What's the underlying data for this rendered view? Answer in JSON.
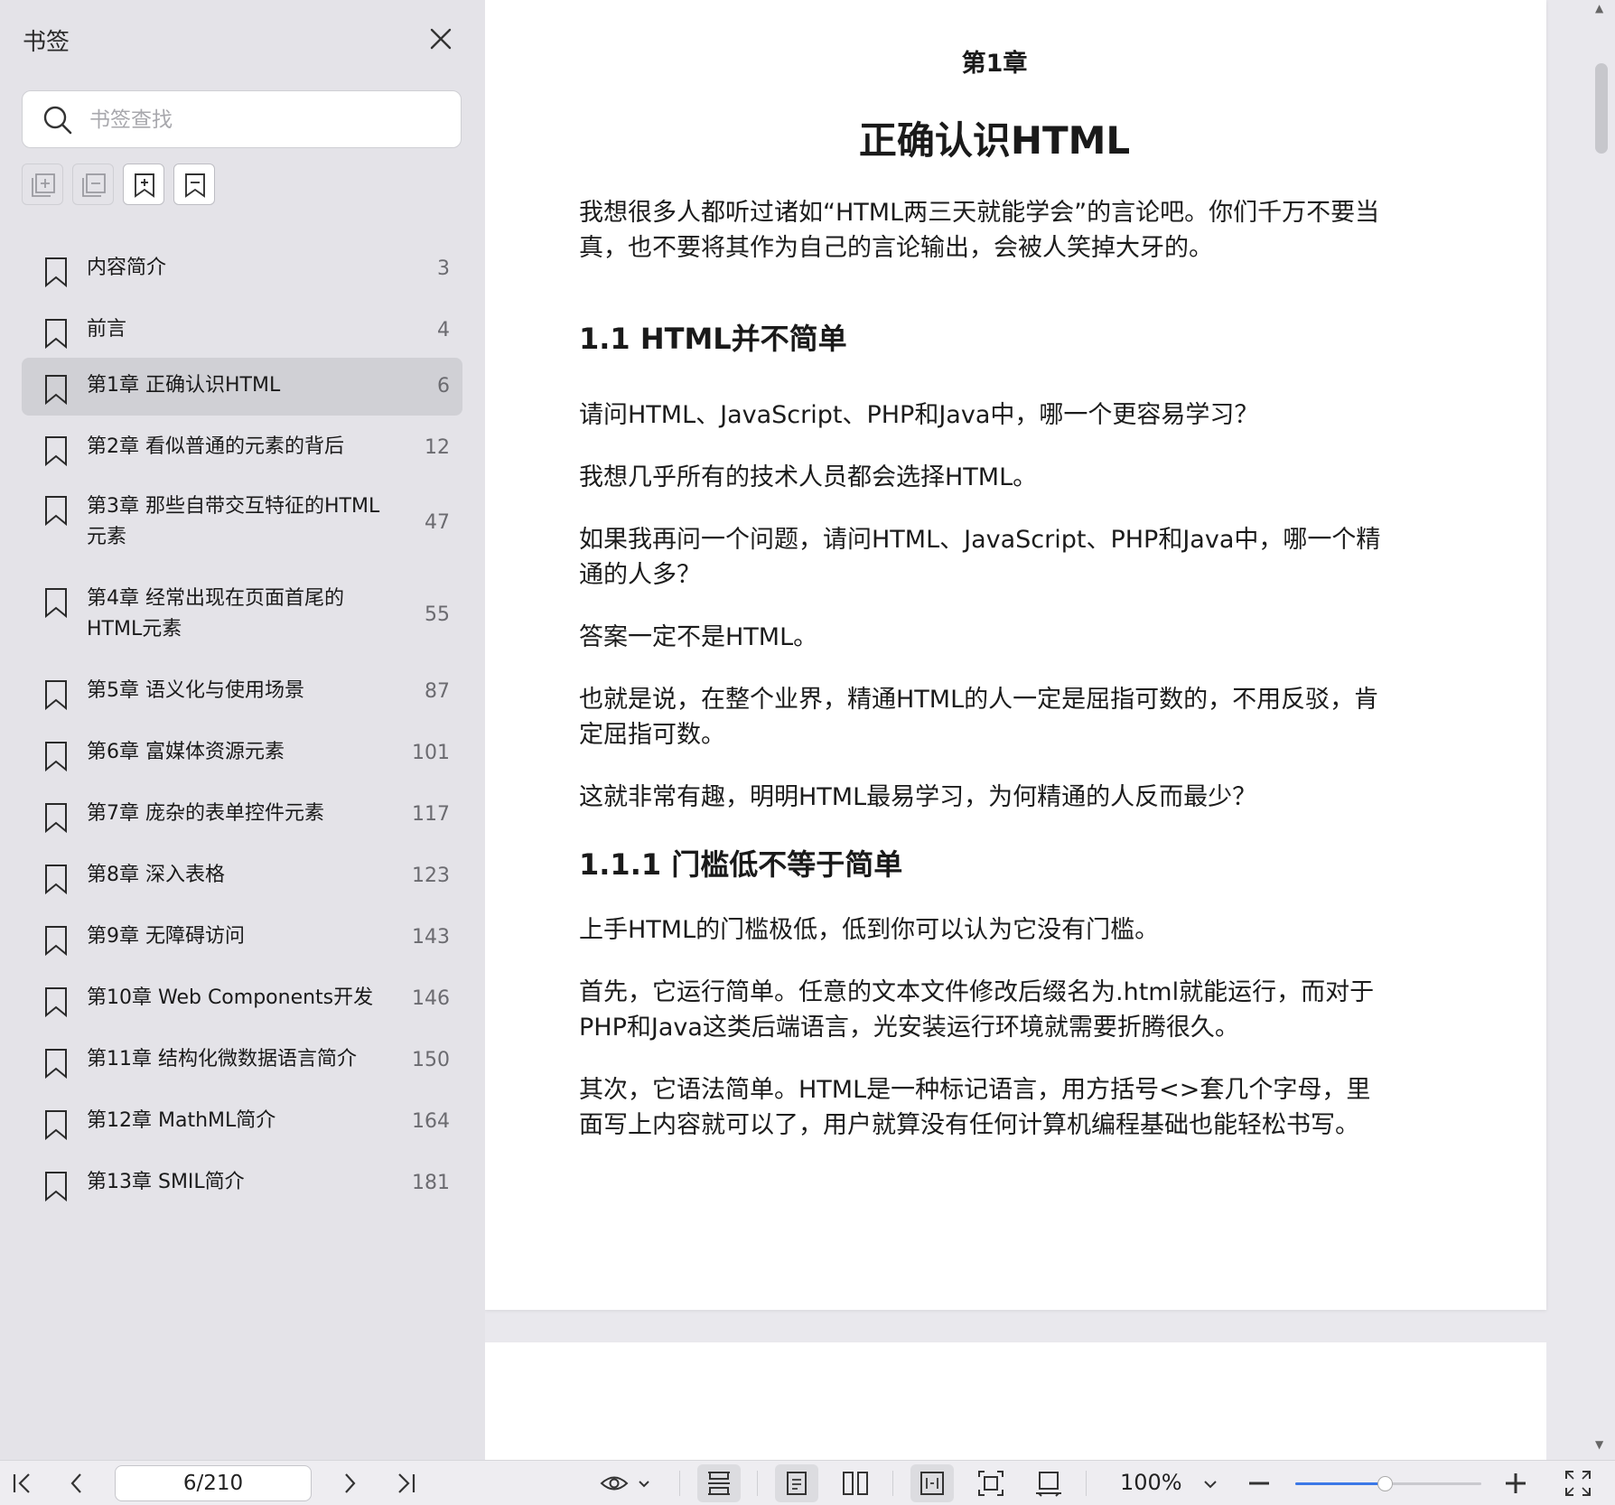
{
  "sidebar": {
    "title": "书签",
    "search_placeholder": "书签查找",
    "tools": [
      "expand-all-icon",
      "collapse-all-icon",
      "add-bookmark-icon",
      "bookmark-icon"
    ],
    "items": [
      {
        "label": "内容简介",
        "page": "3"
      },
      {
        "label": "前言",
        "page": "4"
      },
      {
        "label": "第1章 正确认识HTML",
        "page": "6",
        "active": true
      },
      {
        "label": "第2章 看似普通的元素的背后",
        "page": "12"
      },
      {
        "label": "第3章 那些自带交互特征的HTML元素",
        "page": "47"
      },
      {
        "label": "第4章 经常出现在页面首尾的HTML元素",
        "page": "55"
      },
      {
        "label": "第5章 语义化与使用场景",
        "page": "87"
      },
      {
        "label": "第6章 富媒体资源元素",
        "page": "101"
      },
      {
        "label": "第7章 庞杂的表单控件元素",
        "page": "117"
      },
      {
        "label": "第8章 深入表格",
        "page": "123"
      },
      {
        "label": "第9章 无障碍访问",
        "page": "143"
      },
      {
        "label": "第10章 Web Components开发",
        "page": "146"
      },
      {
        "label": "第11章 结构化微数据语言简介",
        "page": "150"
      },
      {
        "label": "第12章 MathML简介",
        "page": "164"
      },
      {
        "label": "第13章 SMIL简介",
        "page": "181"
      }
    ]
  },
  "document": {
    "chapter_label": "第1章",
    "chapter_title": "正确认识HTML",
    "intro": "我想很多人都听过诸如“HTML两三天就能学会”的言论吧。你们千万不要当真，也不要将其作为自己的言论输出，会被人笑掉大牙的。",
    "h2": "1.1 HTML并不简单",
    "p1": "请问HTML、JavaScript、PHP和Java中，哪一个更容易学习？",
    "p2": "我想几乎所有的技术人员都会选择HTML。",
    "p3": "如果我再问一个问题，请问HTML、JavaScript、PHP和Java中，哪一个精通的人多？",
    "p4": "答案一定不是HTML。",
    "p5": "也就是说，在整个业界，精通HTML的人一定是屈指可数的，不用反驳，肯定屈指可数。",
    "p6": "这就非常有趣，明明HTML最易学习，为何精通的人反而最少？",
    "h3": "1.1.1 门槛低不等于简单",
    "p7": "上手HTML的门槛极低，低到你可以认为它没有门槛。",
    "p8": "首先，它运行简单。任意的文本文件修改后缀名为.html就能运行，而对于PHP和Java这类后端语言，光安装运行环境就需要折腾很久。",
    "p9": "其次，它语法简单。HTML是一种标记语言，用方括号<>套几个字母，里面写上内容就可以了，用户就算没有任何计算机编程基础也能轻松书写。"
  },
  "toolbar": {
    "page_value": "6/210",
    "zoom_label": "100%",
    "zoom_level": 0.48,
    "accent_color": "#3b78e7"
  }
}
